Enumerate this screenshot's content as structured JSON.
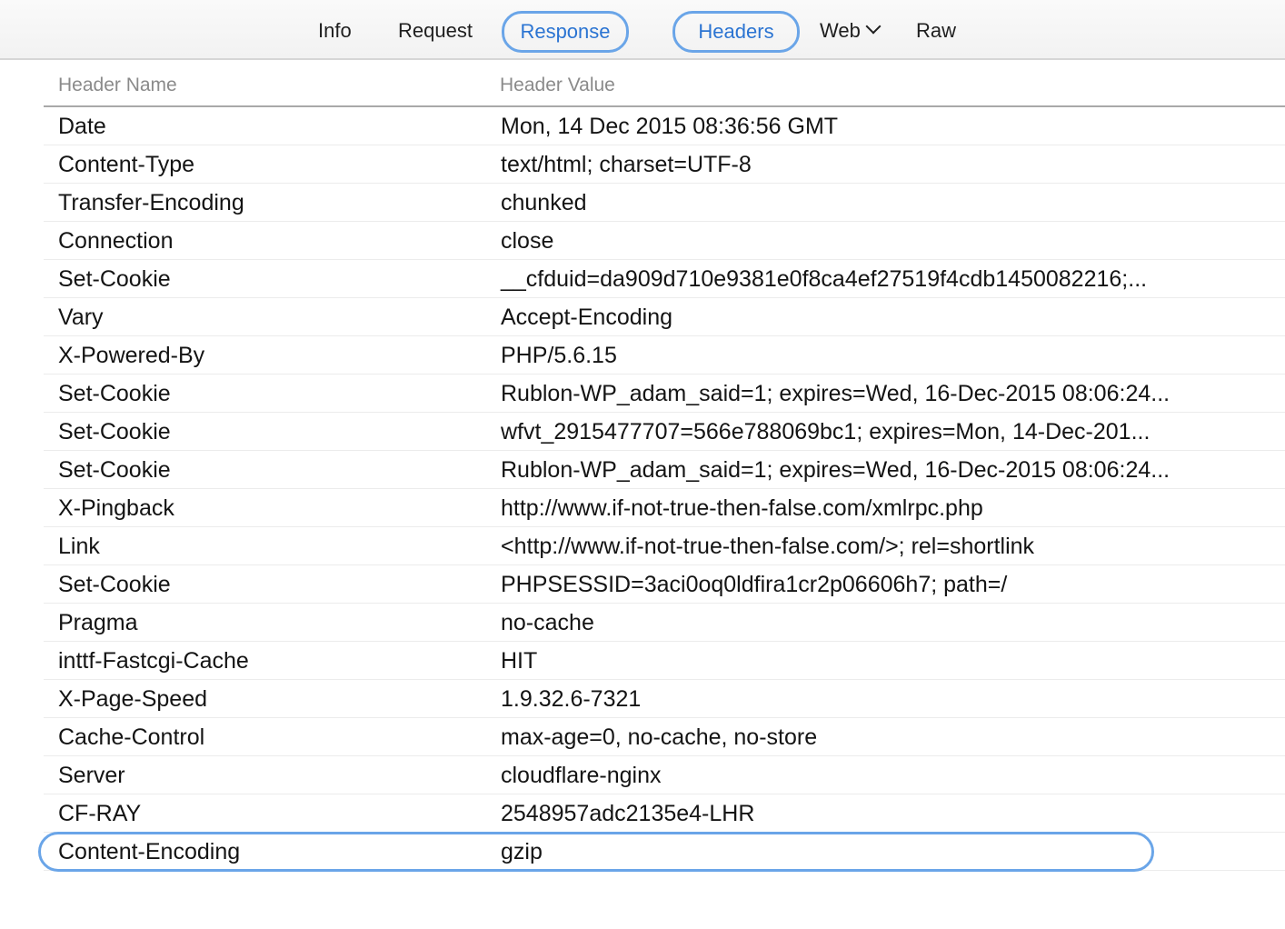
{
  "tabs": {
    "info": "Info",
    "request": "Request",
    "response": "Response",
    "headers": "Headers",
    "web": "Web",
    "raw": "Raw"
  },
  "table": {
    "columns": {
      "name": "Header Name",
      "value": "Header Value"
    },
    "rows": [
      {
        "name": "Date",
        "value": "Mon, 14 Dec 2015 08:36:56 GMT"
      },
      {
        "name": "Content-Type",
        "value": "text/html; charset=UTF-8"
      },
      {
        "name": "Transfer-Encoding",
        "value": "chunked"
      },
      {
        "name": "Connection",
        "value": "close"
      },
      {
        "name": "Set-Cookie",
        "value": "__cfduid=da909d710e9381e0f8ca4ef27519f4cdb1450082216;..."
      },
      {
        "name": "Vary",
        "value": "Accept-Encoding"
      },
      {
        "name": "X-Powered-By",
        "value": "PHP/5.6.15"
      },
      {
        "name": "Set-Cookie",
        "value": "Rublon-WP_adam_said=1; expires=Wed, 16-Dec-2015 08:06:24..."
      },
      {
        "name": "Set-Cookie",
        "value": "wfvt_2915477707=566e788069bc1; expires=Mon, 14-Dec-201..."
      },
      {
        "name": "Set-Cookie",
        "value": "Rublon-WP_adam_said=1; expires=Wed, 16-Dec-2015 08:06:24..."
      },
      {
        "name": "X-Pingback",
        "value": "http://www.if-not-true-then-false.com/xmlrpc.php"
      },
      {
        "name": "Link",
        "value": "<http://www.if-not-true-then-false.com/>; rel=shortlink"
      },
      {
        "name": "Set-Cookie",
        "value": "PHPSESSID=3aci0oq0ldfira1cr2p06606h7; path=/"
      },
      {
        "name": "Pragma",
        "value": "no-cache"
      },
      {
        "name": "inttf-Fastcgi-Cache",
        "value": "HIT"
      },
      {
        "name": "X-Page-Speed",
        "value": "1.9.32.6-7321"
      },
      {
        "name": "Cache-Control",
        "value": "max-age=0, no-cache, no-store"
      },
      {
        "name": "Server",
        "value": "cloudflare-nginx"
      },
      {
        "name": "CF-RAY",
        "value": "2548957adc2135e4-LHR"
      },
      {
        "name": "Content-Encoding",
        "value": "gzip"
      }
    ]
  },
  "colors": {
    "accent": "#2b74d2",
    "highlight_outline": "#6aa5e8"
  }
}
